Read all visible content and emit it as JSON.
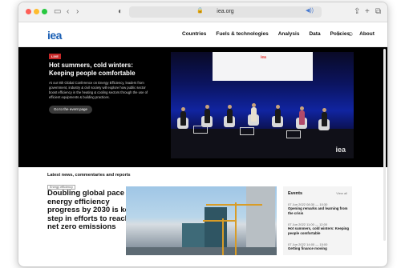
{
  "browser": {
    "url": "iea.org",
    "nav_icons": {
      "sidebar": "sidebar-icon",
      "back": "back-icon",
      "forward": "forward-icon",
      "shield": "shield-icon",
      "share": "share-icon",
      "newtab": "plus-icon",
      "tabs": "tabs-icon"
    }
  },
  "site": {
    "logo": "iea",
    "nav": [
      "Countries",
      "Fuels & technologies",
      "Analysis",
      "Data",
      "Policies",
      "About"
    ]
  },
  "hero": {
    "live_badge": "LIVE",
    "title": "Hot summers, cold winters: Keeping people comfortable",
    "text": "At our 8th Global Conference on Energy Efficiency, leaders from government, industry & civil society will explore how public sector boost efficiency in the heating & cooling sectors through the use of efficient equipments & building practices.",
    "button": "Go to the event page",
    "video_badge": "iea",
    "video_logo": "iea"
  },
  "news": {
    "heading": "Latest news, commentaries and reports",
    "tag": "Energy efficiency",
    "title": "Doubling global pace of energy efficiency progress by 2030 is key step in efforts to reach net zero emissions"
  },
  "events": {
    "title": "Events",
    "view_all": "View all",
    "items": [
      {
        "time": "07 Jun 2022 08:30 — 10:30",
        "name": "Opening remarks and learning from the crisis"
      },
      {
        "time": "07 Jun 2022 11:00 — 12:00",
        "name": "Hot summers, cold winters: Keeping people comfortable"
      },
      {
        "time": "07 Jun 2022 14:00 — 15:00",
        "name": "Getting finance moving"
      }
    ]
  }
}
